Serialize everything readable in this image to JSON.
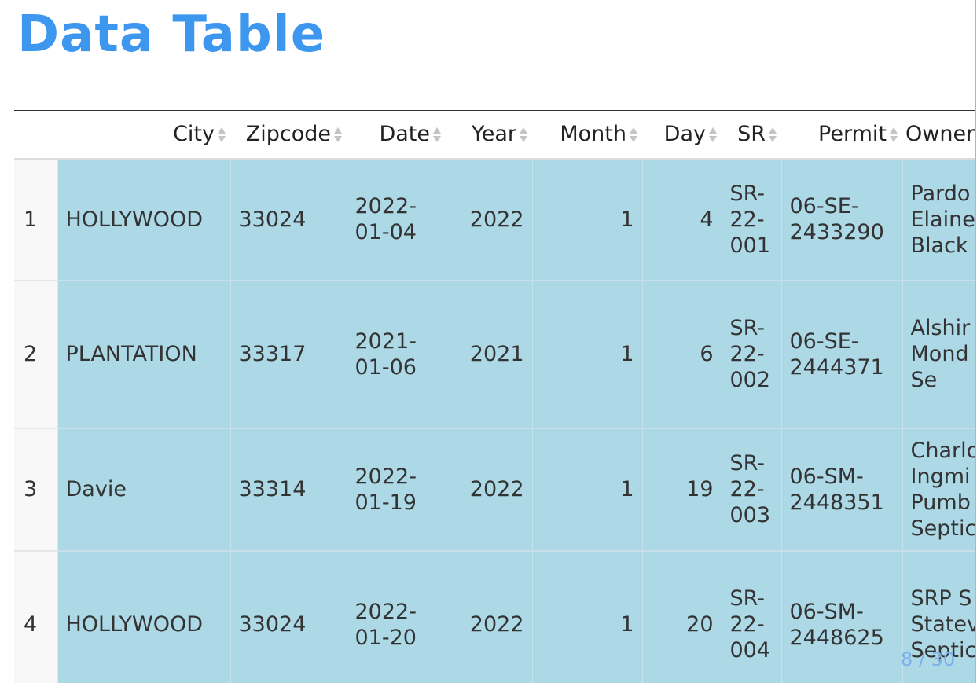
{
  "page": {
    "title": "Data Table"
  },
  "table": {
    "columns": [
      "",
      "City",
      "Zipcode",
      "Date",
      "Year",
      "Month",
      "Day",
      "SR",
      "Permit",
      "Owner"
    ],
    "rows": [
      {
        "index": "1",
        "city": "HOLLYWOOD",
        "zipcode": "33024",
        "date": "2022-01-04",
        "year": "2022",
        "month": "1",
        "day": "4",
        "sr": "SR-22-001",
        "permit": "06-SE-2433290",
        "owner": "Pardo Elaine Black Co"
      },
      {
        "index": "2",
        "city": "PLANTATION",
        "zipcode": "33317",
        "date": "2021-01-06",
        "year": "2021",
        "month": "1",
        "day": "6",
        "sr": "SR-22-002",
        "permit": "06-SE-2444371",
        "owner": "Alshir Mond Top Se"
      },
      {
        "index": "3",
        "city": "Davie",
        "zipcode": "33314",
        "date": "2022-01-19",
        "year": "2022",
        "month": "1",
        "day": "19",
        "sr": "SR-22-003",
        "permit": "06-SM-2448351",
        "owner": "Charlo Ingmi Pumb Septic"
      },
      {
        "index": "4",
        "city": "HOLLYWOOD",
        "zipcode": "33024",
        "date": "2022-01-20",
        "year": "2022",
        "month": "1",
        "day": "20",
        "sr": "SR-22-004",
        "permit": "06-SM-2448625",
        "owner": "SRP S Statev Septic Inc"
      }
    ]
  },
  "pager": {
    "text": "8 / 30"
  }
}
